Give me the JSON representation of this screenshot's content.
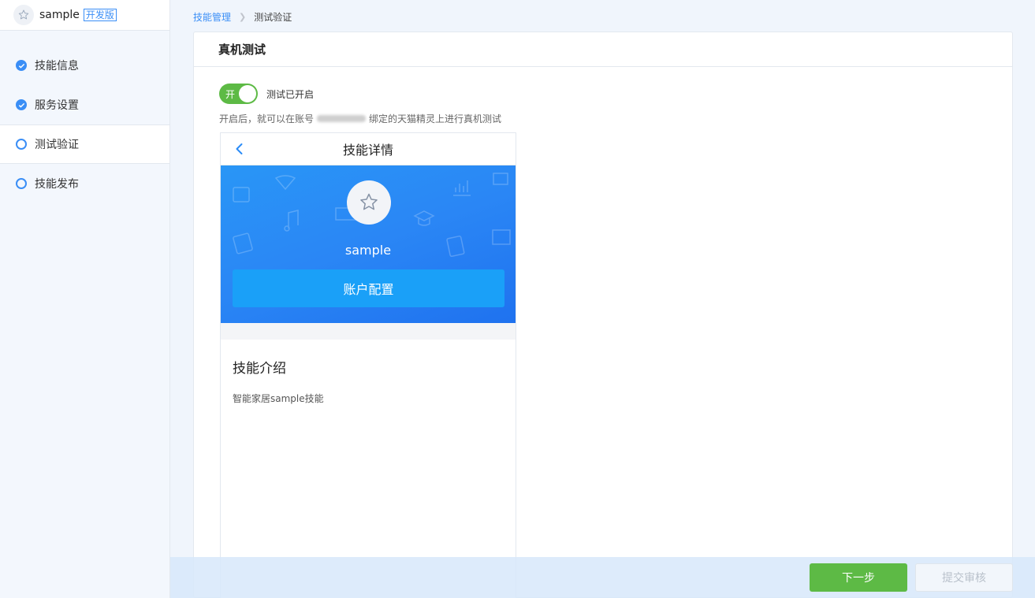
{
  "sidebar": {
    "app_name": "sample",
    "badge": "开发版",
    "steps": [
      {
        "label": "技能信息",
        "state": "done"
      },
      {
        "label": "服务设置",
        "state": "done"
      },
      {
        "label": "测试验证",
        "state": "active"
      },
      {
        "label": "技能发布",
        "state": "todo"
      }
    ]
  },
  "breadcrumb": {
    "parent": "技能管理",
    "current": "测试验证"
  },
  "card": {
    "title": "真机测试",
    "toggle_text": "开",
    "toggle_label": "测试已开启",
    "toggle_on": true,
    "hint_before": "开启后，就可以在账号",
    "hint_after": "绑定的天猫精灵上进行真机测试"
  },
  "phone": {
    "title": "技能详情",
    "skill_name": "sample",
    "account_button": "账户配置",
    "intro_title": "技能介绍",
    "intro_text": "智能家居sample技能"
  },
  "footer": {
    "next_label": "下一步",
    "submit_label": "提交审核"
  },
  "colors": {
    "accent": "#3a8ef6",
    "success": "#5dba45",
    "banner": "#2a86f5",
    "account_button": "#1aa0f8"
  }
}
